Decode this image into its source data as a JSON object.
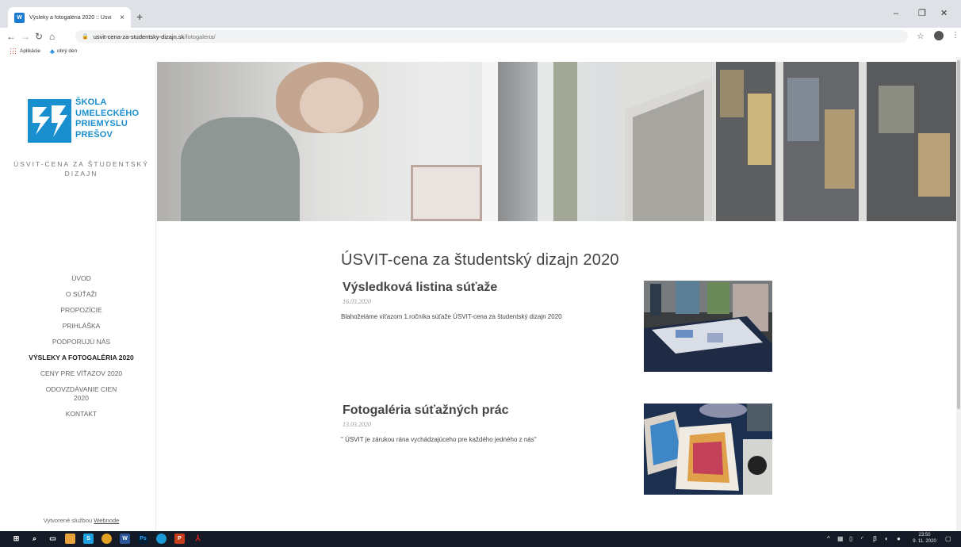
{
  "browser": {
    "tab_title": "Výsleky a fotogaléria 2020 :: Úsvi",
    "tab_close": "×",
    "new_tab": "+",
    "url_host": "usvit-cena-za-studentsky-dizajn.sk",
    "url_path": "/fotogaleria/",
    "bookmarks": [
      {
        "label": "Aplikácie",
        "icon": "apps-grid-icon"
      },
      {
        "label": "obrý den",
        "icon": "people-icon"
      }
    ]
  },
  "site": {
    "logo_lines": [
      "ŠKOLA",
      "UMELECKÉHO",
      "PRIEMYSLU",
      "PREŠOV"
    ],
    "tagline": "ÚSVIT-CENA ZA ŠTUDENTSKÝ DIZAJN",
    "nav": [
      "ÚVOD",
      "O SÚŤAŽI",
      "PROPOZÍCIE",
      "PRIHLÁŠKA",
      "PODPORUJÚ NÁS",
      "VÝSLEKY A FOTOGALÉRIA 2020",
      "CENY PRE VÍŤAZOV 2020",
      "ODOVZDÁVANIE CIEN 2020",
      "KONTAKT"
    ],
    "nav_active_index": 5,
    "credit_prefix": "Vytvorené službou ",
    "credit_link": "Webnode",
    "page_title": "ÚSVIT-cena za študentský dizajn 2020",
    "articles": [
      {
        "title": "Výsledková listina súťaže",
        "date": "16.03.2020",
        "text": "Blahoželáme víťazom 1.ročníka súťaže ÚSVIT-cena za študentský dizajn 2020"
      },
      {
        "title": "Fotogaléria súťažných prác",
        "date": "13.03.2020",
        "text": "\" ÚSVIT je zárukou rána vychádzajúceho pre každého jedného z nás\""
      }
    ]
  },
  "taskbar": {
    "time": "23:50",
    "date": "9. 11. 2020"
  },
  "colors": {
    "logo_blue": "#1a8fd0",
    "taskbar": "#151b26"
  }
}
